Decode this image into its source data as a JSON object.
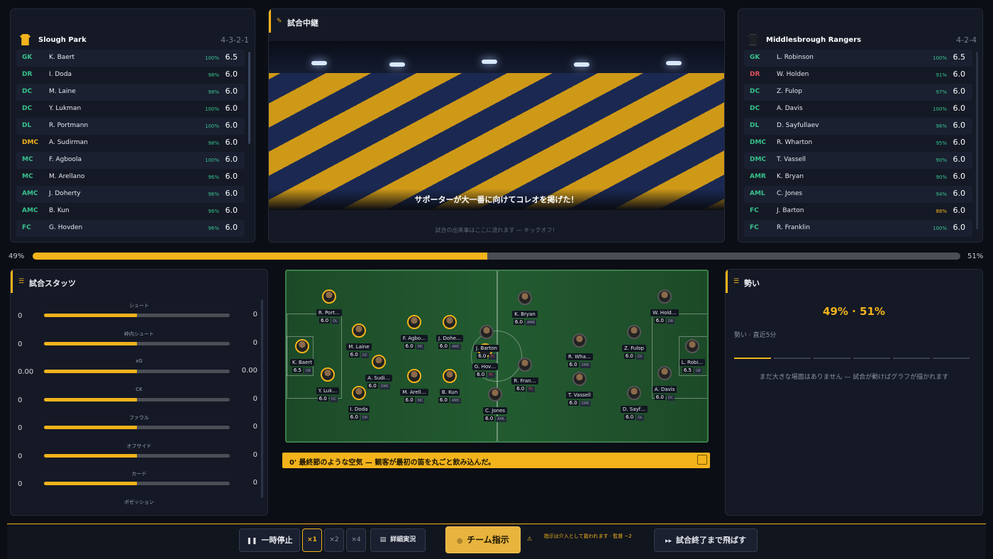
{
  "home": {
    "name": "Slough Park",
    "formation": "4-3-2-1",
    "players": [
      {
        "pos": "GK",
        "name": "K. Baert",
        "fit": "100%",
        "rating": "6.5"
      },
      {
        "pos": "DR",
        "name": "I. Doda",
        "fit": "98%",
        "rating": "6.0"
      },
      {
        "pos": "DC",
        "name": "M. Laine",
        "fit": "98%",
        "rating": "6.0"
      },
      {
        "pos": "DC",
        "name": "Y. Lukman",
        "fit": "100%",
        "rating": "6.0"
      },
      {
        "pos": "DL",
        "name": "R. Portmann",
        "fit": "100%",
        "rating": "6.0"
      },
      {
        "pos": "DMC",
        "name": "A. Sudirman",
        "fit": "98%",
        "rating": "6.0"
      },
      {
        "pos": "MC",
        "name": "F. Agboola",
        "fit": "100%",
        "rating": "6.0"
      },
      {
        "pos": "MC",
        "name": "M. Arellano",
        "fit": "96%",
        "rating": "6.0"
      },
      {
        "pos": "AMC",
        "name": "J. Doherty",
        "fit": "96%",
        "rating": "6.0"
      },
      {
        "pos": "AMC",
        "name": "B. Kun",
        "fit": "96%",
        "rating": "6.0"
      },
      {
        "pos": "FC",
        "name": "G. Hovden",
        "fit": "96%",
        "rating": "6.0"
      }
    ]
  },
  "away": {
    "name": "Middlesbrough Rangers",
    "formation": "4-2-4",
    "players": [
      {
        "pos": "GK",
        "name": "L. Robinson",
        "fit": "100%",
        "rating": "6.5"
      },
      {
        "pos": "DR",
        "name": "W. Holden",
        "fit": "91%",
        "rating": "6.0"
      },
      {
        "pos": "DC",
        "name": "Z. Fulop",
        "fit": "97%",
        "rating": "6.0"
      },
      {
        "pos": "DC",
        "name": "A. Davis",
        "fit": "100%",
        "rating": "6.0"
      },
      {
        "pos": "DL",
        "name": "D. Sayfullaev",
        "fit": "96%",
        "rating": "6.0"
      },
      {
        "pos": "DMC",
        "name": "R. Wharton",
        "fit": "95%",
        "rating": "6.0"
      },
      {
        "pos": "DMC",
        "name": "T. Vassell",
        "fit": "90%",
        "rating": "6.0"
      },
      {
        "pos": "AMR",
        "name": "K. Bryan",
        "fit": "90%",
        "rating": "6.0"
      },
      {
        "pos": "AML",
        "name": "C. Jones",
        "fit": "94%",
        "rating": "6.0"
      },
      {
        "pos": "FC",
        "name": "J. Barton",
        "fit": "88%",
        "rating": "6.0"
      },
      {
        "pos": "FC",
        "name": "R. Franklin",
        "fit": "100%",
        "rating": "6.0"
      }
    ]
  },
  "live": {
    "title": "試合中継",
    "caption": "サポーターが大一番に向けてコレオを掲げた！",
    "feed": "試合の出来事はここに流れます — キックオフ！"
  },
  "momentum_bar": {
    "left": "49%",
    "right": "51%",
    "value": 0.49
  },
  "stats": {
    "title": "試合スタッツ",
    "rows": [
      {
        "label": "シュート",
        "home": "0",
        "away": "0",
        "share": 0.5
      },
      {
        "label": "枠内シュート",
        "home": "0",
        "away": "0",
        "share": 0.5
      },
      {
        "label": "xG",
        "home": "0.00",
        "away": "0.00",
        "share": 0.5
      },
      {
        "label": "CK",
        "home": "0",
        "away": "0",
        "share": 0.5
      },
      {
        "label": "ファウル",
        "home": "0",
        "away": "0",
        "share": 0.5
      },
      {
        "label": "オフサイド",
        "home": "0",
        "away": "0",
        "share": 0.5
      },
      {
        "label": "カード",
        "home": "0",
        "away": "0",
        "share": 0.5
      },
      {
        "label": "ポゼッション",
        "home": "",
        "away": "",
        "share": 0.5
      }
    ]
  },
  "pitch": {
    "players": [
      {
        "n": "K. Baert",
        "r": "6.5",
        "p": "GK",
        "t": "h"
      },
      {
        "n": "R. Port…",
        "r": "6.0",
        "p": "DL",
        "t": "h"
      },
      {
        "n": "M. Laine",
        "r": "6.0",
        "p": "DC",
        "t": "h"
      },
      {
        "n": "Y. Luk…",
        "r": "6.0",
        "p": "DC",
        "t": "h"
      },
      {
        "n": "I. Doda",
        "r": "6.0",
        "p": "DR",
        "t": "h"
      },
      {
        "n": "A. Sudi…",
        "r": "6.0",
        "p": "DMC",
        "t": "h"
      },
      {
        "n": "F. Agbo…",
        "r": "6.0",
        "p": "MC",
        "t": "h"
      },
      {
        "n": "M. Arell…",
        "r": "6.0",
        "p": "MC",
        "t": "h"
      },
      {
        "n": "J. Dohe…",
        "r": "6.0",
        "p": "AMC",
        "t": "h"
      },
      {
        "n": "B. Kun",
        "r": "6.0",
        "p": "AMC",
        "t": "h"
      },
      {
        "n": "G. Hov…",
        "r": "6.0",
        "p": "FC",
        "t": "h"
      },
      {
        "n": "J. Barton",
        "r": "6.0",
        "p": "FC",
        "t": "a"
      },
      {
        "n": "R. Fran…",
        "r": "6.0",
        "p": "FC",
        "t": "a"
      },
      {
        "n": "K. Bryan",
        "r": "6.0",
        "p": "AMR",
        "t": "a"
      },
      {
        "n": "C. Jones",
        "r": "6.0",
        "p": "AML",
        "t": "a"
      },
      {
        "n": "R. Wha…",
        "r": "6.0",
        "p": "DMC",
        "t": "a"
      },
      {
        "n": "T. Vassell",
        "r": "6.0",
        "p": "DMC",
        "t": "a"
      },
      {
        "n": "W. Hold…",
        "r": "6.0",
        "p": "DR",
        "t": "a"
      },
      {
        "n": "Z. Fulop",
        "r": "6.0",
        "p": "DC",
        "t": "a"
      },
      {
        "n": "A. Davis",
        "r": "6.0",
        "p": "DC",
        "t": "a"
      },
      {
        "n": "D. Sayf…",
        "r": "6.0",
        "p": "DL",
        "t": "a"
      },
      {
        "n": "L. Robi…",
        "r": "6.5",
        "p": "GK",
        "t": "a"
      }
    ]
  },
  "ticker": {
    "text": "0'   最終節のような空気 — 観客が最初の笛を丸ごと飲み込んだ。"
  },
  "momentum": {
    "title": "勢い",
    "value": "49% · 51%",
    "sub": "勢い · 直近5分",
    "note": "まだ大きな場面はありません — 試合が動けばグラフが描かれます"
  },
  "controls": {
    "pause": "一時停止",
    "speed1": "×1",
    "speed2": "×2",
    "speed4": "×4",
    "detail": "詳細実況",
    "team": "チーム指示",
    "hint": "指示は介入として扱われます · 監督 −2",
    "skip": "試合終了まで飛ばす"
  },
  "colors": {
    "accent": "#f2b31b",
    "panel": "#141925",
    "background": "#0b0e14"
  }
}
